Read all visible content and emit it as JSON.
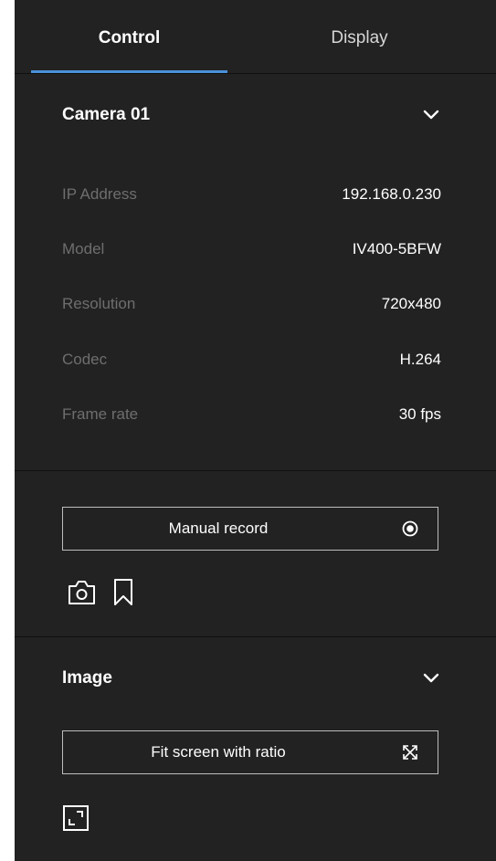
{
  "tabs": {
    "control_label": "Control",
    "display_label": "Display"
  },
  "camera": {
    "title": "Camera 01",
    "rows": [
      {
        "label": "IP Address",
        "value": "192.168.0.230"
      },
      {
        "label": "Model",
        "value": "IV400-5BFW"
      },
      {
        "label": "Resolution",
        "value": "720x480"
      },
      {
        "label": "Codec",
        "value": "H.264"
      },
      {
        "label": "Frame rate",
        "value": "30 fps"
      }
    ]
  },
  "recording": {
    "manual_record_label": "Manual record"
  },
  "image": {
    "title": "Image",
    "fit_screen_label": "Fit screen with ratio"
  },
  "icons": {
    "camera_chevron": "chevron-down-icon",
    "record": "record-icon",
    "snapshot": "camera-icon",
    "bookmark": "bookmark-icon",
    "image_chevron": "chevron-down-icon",
    "fit_screen": "expand-arrows-icon",
    "fullscreen": "fullscreen-icon"
  },
  "colors": {
    "panel_background": "#222222",
    "accent": "#4a90d9",
    "label_muted": "#6e6e6e",
    "text": "#ffffff"
  }
}
